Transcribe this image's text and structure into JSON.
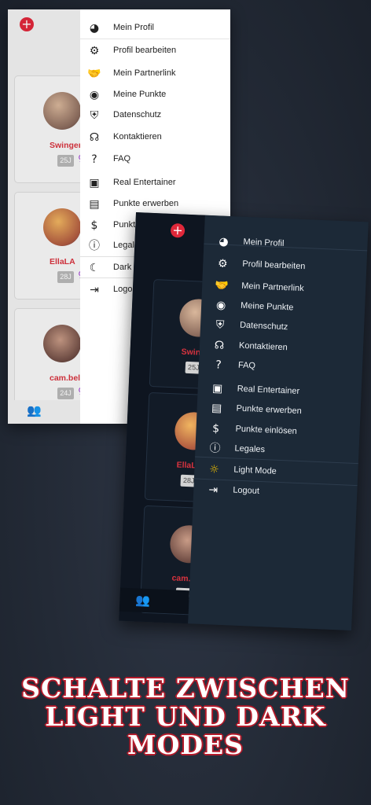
{
  "light_phone": {
    "cards": [
      {
        "name": "Swingerel",
        "age": "25J"
      },
      {
        "name": "EllaLA",
        "age": "28J"
      },
      {
        "name": "cam.bella",
        "age": "24J"
      }
    ],
    "menu": [
      {
        "icon": "user-circle-icon",
        "label": "Mein Profil"
      },
      {
        "icon": "gear-icon",
        "label": "Profil bearbeiten"
      },
      {
        "icon": "handshake-icon",
        "label": "Mein Partnerlink"
      },
      {
        "icon": "coins-icon",
        "label": "Meine Punkte"
      },
      {
        "icon": "shield-icon",
        "label": "Datenschutz"
      },
      {
        "icon": "headset-icon",
        "label": "Kontaktieren"
      },
      {
        "icon": "question-icon",
        "label": "FAQ"
      },
      {
        "icon": "id-badge-icon",
        "label": "Real Entertainer"
      },
      {
        "icon": "money-bill-icon",
        "label": "Punkte erwerben"
      },
      {
        "icon": "dollar-file-icon",
        "label": "Punkte einlö"
      },
      {
        "icon": "info-icon",
        "label": "Legales"
      },
      {
        "icon": "moon-icon",
        "label": "Dark Mode"
      },
      {
        "icon": "logout-icon",
        "label": "Logout"
      }
    ]
  },
  "dark_phone": {
    "cards": [
      {
        "name": "Swingerel",
        "age": "25J"
      },
      {
        "name": "EllaLA",
        "age": "28J"
      },
      {
        "name": "cam.bella",
        "age": "24J"
      }
    ],
    "menu": [
      {
        "icon": "user-circle-icon",
        "label": "Mein Profil"
      },
      {
        "icon": "gear-icon",
        "label": "Profil bearbeiten"
      },
      {
        "icon": "handshake-icon",
        "label": "Mein Partnerlink"
      },
      {
        "icon": "coins-icon",
        "label": "Meine Punkte"
      },
      {
        "icon": "shield-icon",
        "label": "Datenschutz"
      },
      {
        "icon": "headset-icon",
        "label": "Kontaktieren"
      },
      {
        "icon": "question-icon",
        "label": "FAQ"
      },
      {
        "icon": "id-badge-icon",
        "label": "Real Entertainer"
      },
      {
        "icon": "money-bill-icon",
        "label": "Punkte erwerben"
      },
      {
        "icon": "dollar-file-icon",
        "label": "Punkte einlösen"
      },
      {
        "icon": "info-icon",
        "label": "Legales"
      },
      {
        "icon": "sun-icon",
        "label": "Light Mode"
      },
      {
        "icon": "logout-icon",
        "label": "Logout"
      }
    ]
  },
  "headline": {
    "line1": "SCHALTE ZWISCHEN",
    "line2": "LIGHT UND DARK",
    "line3": "MODES"
  },
  "colors": {
    "accent_red": "#e0283a",
    "dark_menu_bg": "#1c2937",
    "female_purple": "#a54bd6",
    "sun_yellow": "#f2c200"
  }
}
